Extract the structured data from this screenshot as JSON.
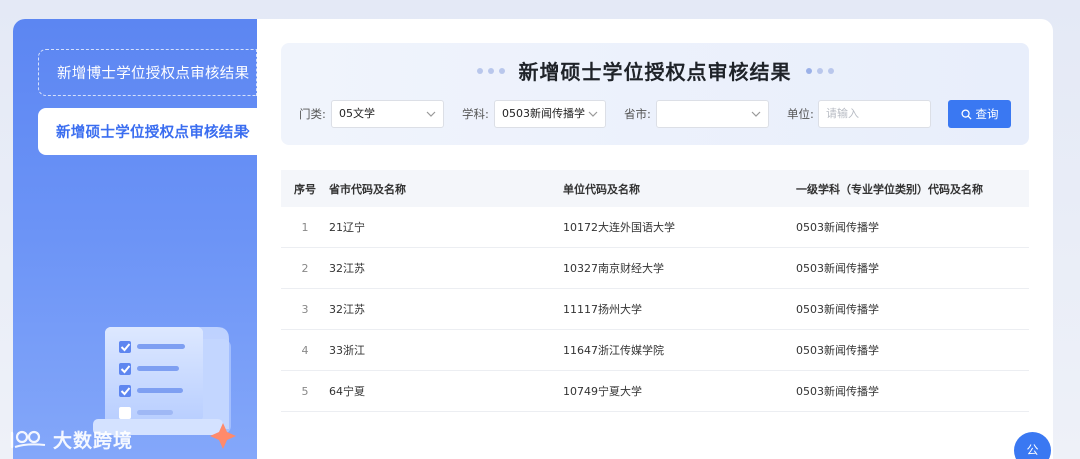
{
  "sidebar": {
    "items": [
      {
        "label": "新增博士学位授权点审核结果",
        "active": false
      },
      {
        "label": "新增硕士学位授权点审核结果",
        "active": true
      }
    ]
  },
  "panel": {
    "title": "新增硕士学位授权点审核结果"
  },
  "filters": {
    "category_label": "门类:",
    "category_value": "05文学",
    "subject_label": "学科:",
    "subject_value": "0503新闻传播学",
    "province_label": "省市:",
    "province_value": "",
    "unit_label": "单位:",
    "unit_placeholder": "请输入",
    "search_label": "查询"
  },
  "table": {
    "headers": [
      "序号",
      "省市代码及名称",
      "单位代码及名称",
      "一级学科（专业学位类别）代码及名称"
    ],
    "rows": [
      [
        "1",
        "21辽宁",
        "10172大连外国语大学",
        "0503新闻传播学"
      ],
      [
        "2",
        "32江苏",
        "10327南京财经大学",
        "0503新闻传播学"
      ],
      [
        "3",
        "32江苏",
        "11117扬州大学",
        "0503新闻传播学"
      ],
      [
        "4",
        "33浙江",
        "11647浙江传媒学院",
        "0503新闻传播学"
      ],
      [
        "5",
        "64宁夏",
        "10749宁夏大学",
        "0503新闻传播学"
      ]
    ]
  },
  "watermark": "大数跨境",
  "float_button": "公",
  "colors": {
    "accent": "#3a78f2",
    "sidebar_top": "#5c86f2",
    "sidebar_bottom": "#86a9fa"
  }
}
